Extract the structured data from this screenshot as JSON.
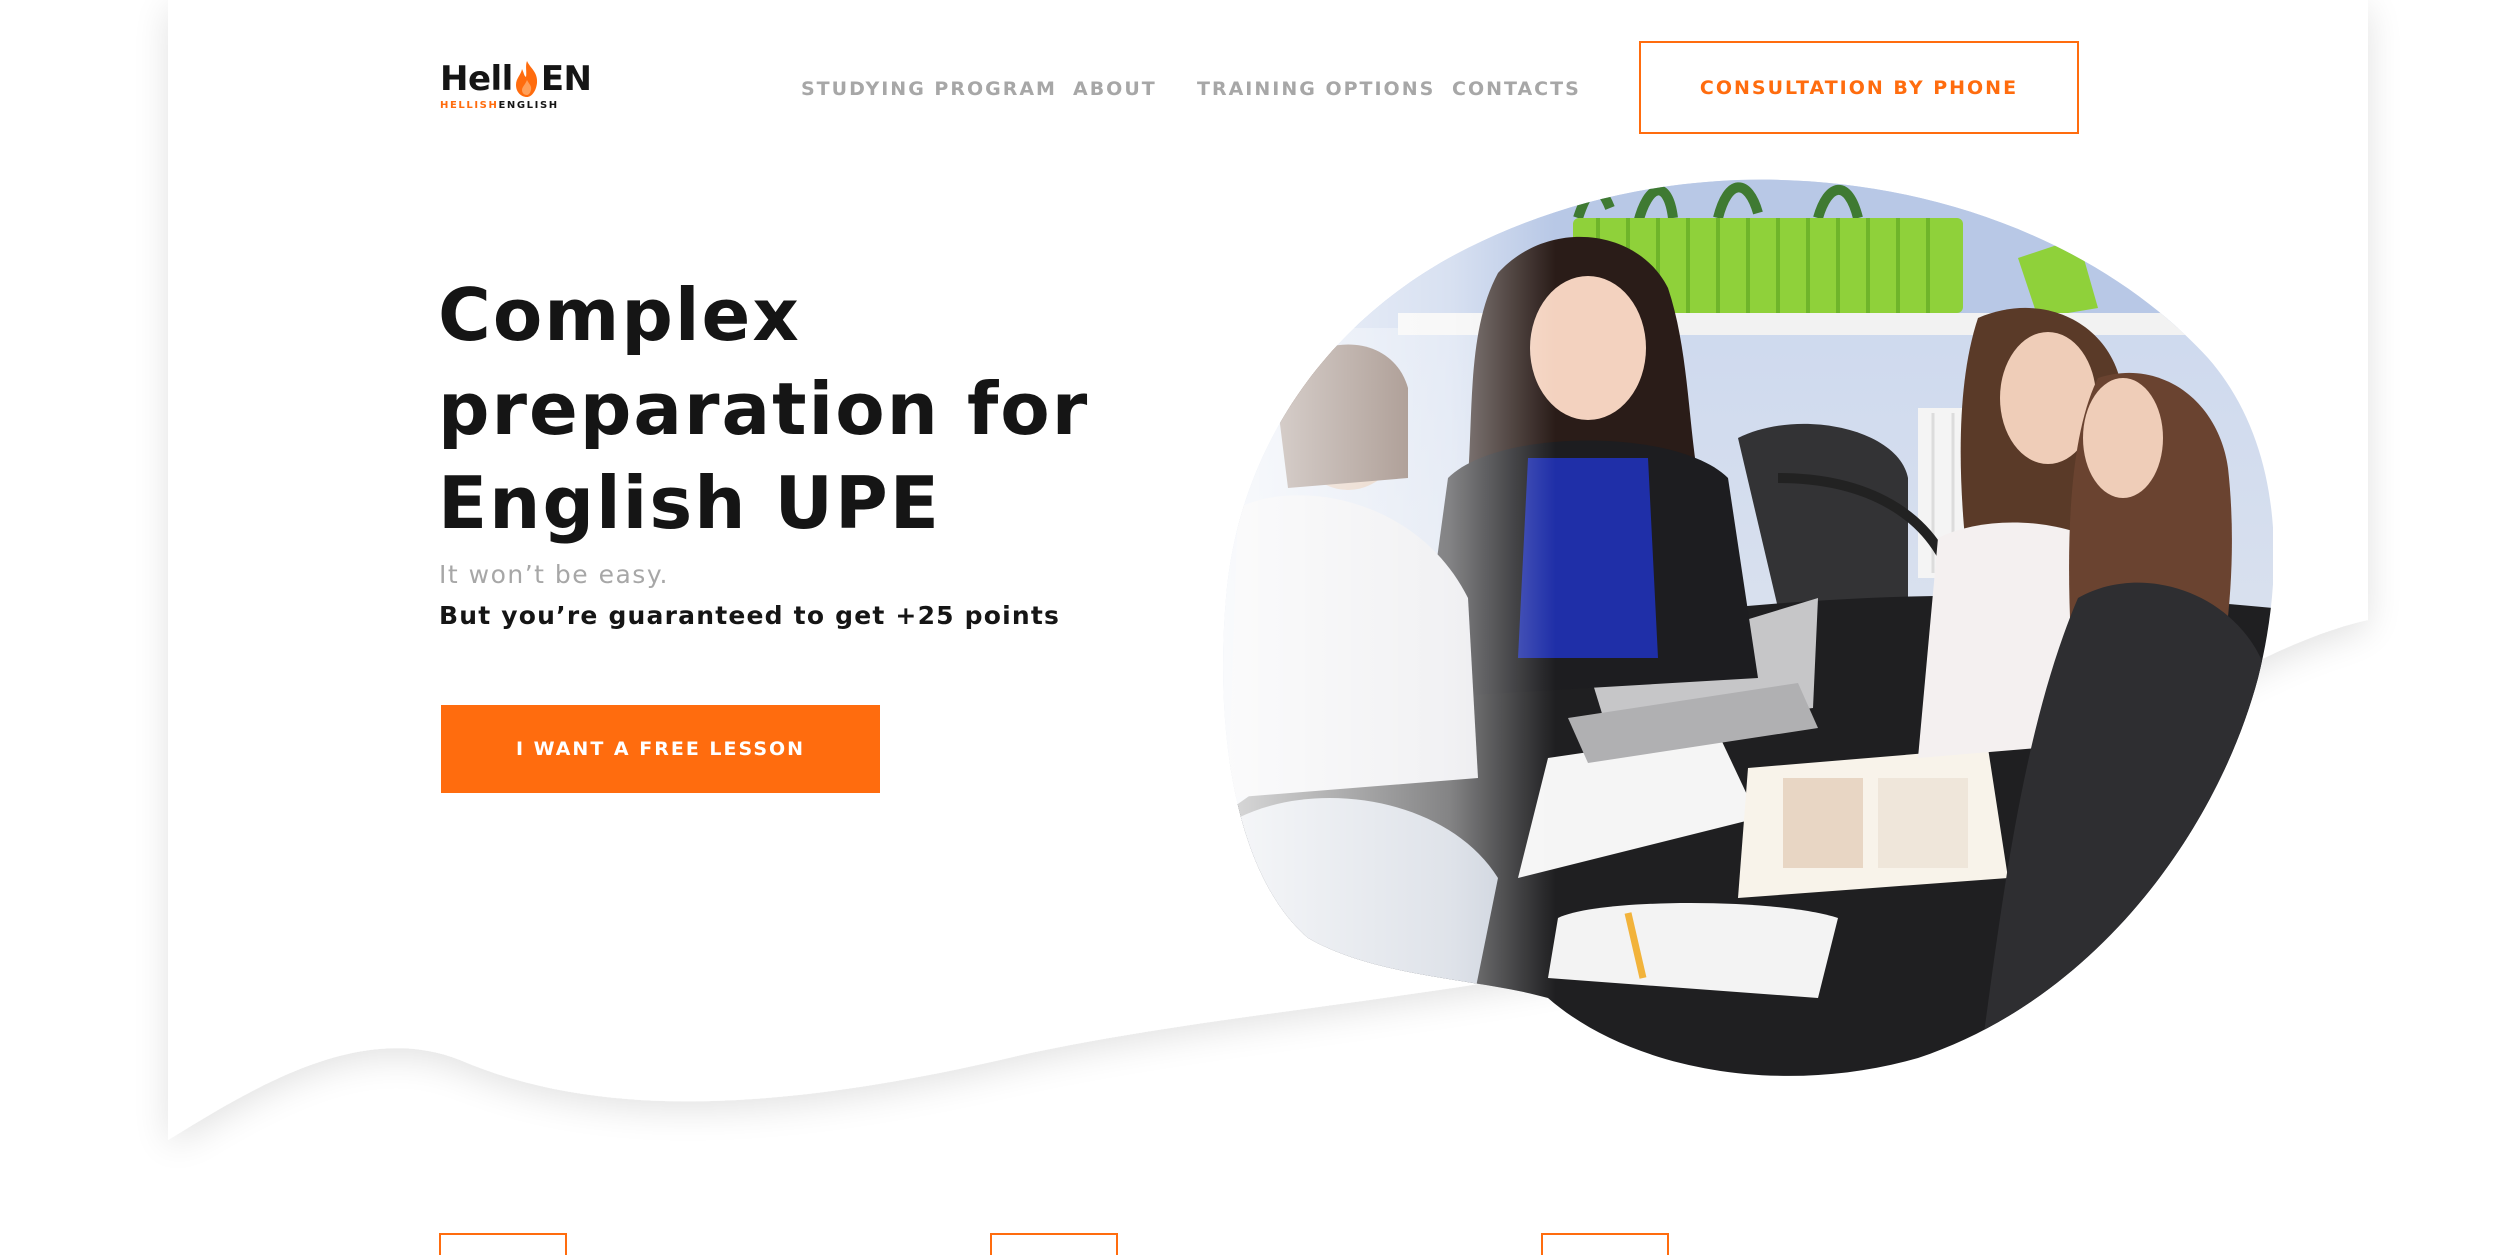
{
  "logo": {
    "prefix": "Hell",
    "suffix": "EN",
    "sub_highlight": "HELLISH",
    "sub_dark": "ENGLISH"
  },
  "nav": {
    "items": [
      {
        "label": "STUDYING PROGRAM"
      },
      {
        "label": "ABOUT"
      },
      {
        "label": "TRAINING OPTIONS"
      },
      {
        "label": "CONTACTS"
      }
    ],
    "cta_label": "CONSULTATION BY PHONE"
  },
  "hero": {
    "title_lines": [
      "Complex",
      "preparation for",
      "English UPE"
    ],
    "subtitle_muted": "It won’t be easy.",
    "subtitle_bold": "But you’re guaranteed to get  +25 points",
    "cta_label": "I WANT A FREE LESSON",
    "photo_icon": "classroom-photo"
  },
  "colors": {
    "accent": "#ff6c0e",
    "text_dark": "#151515",
    "text_muted": "#a7a7a7",
    "background": "#ffffff"
  }
}
